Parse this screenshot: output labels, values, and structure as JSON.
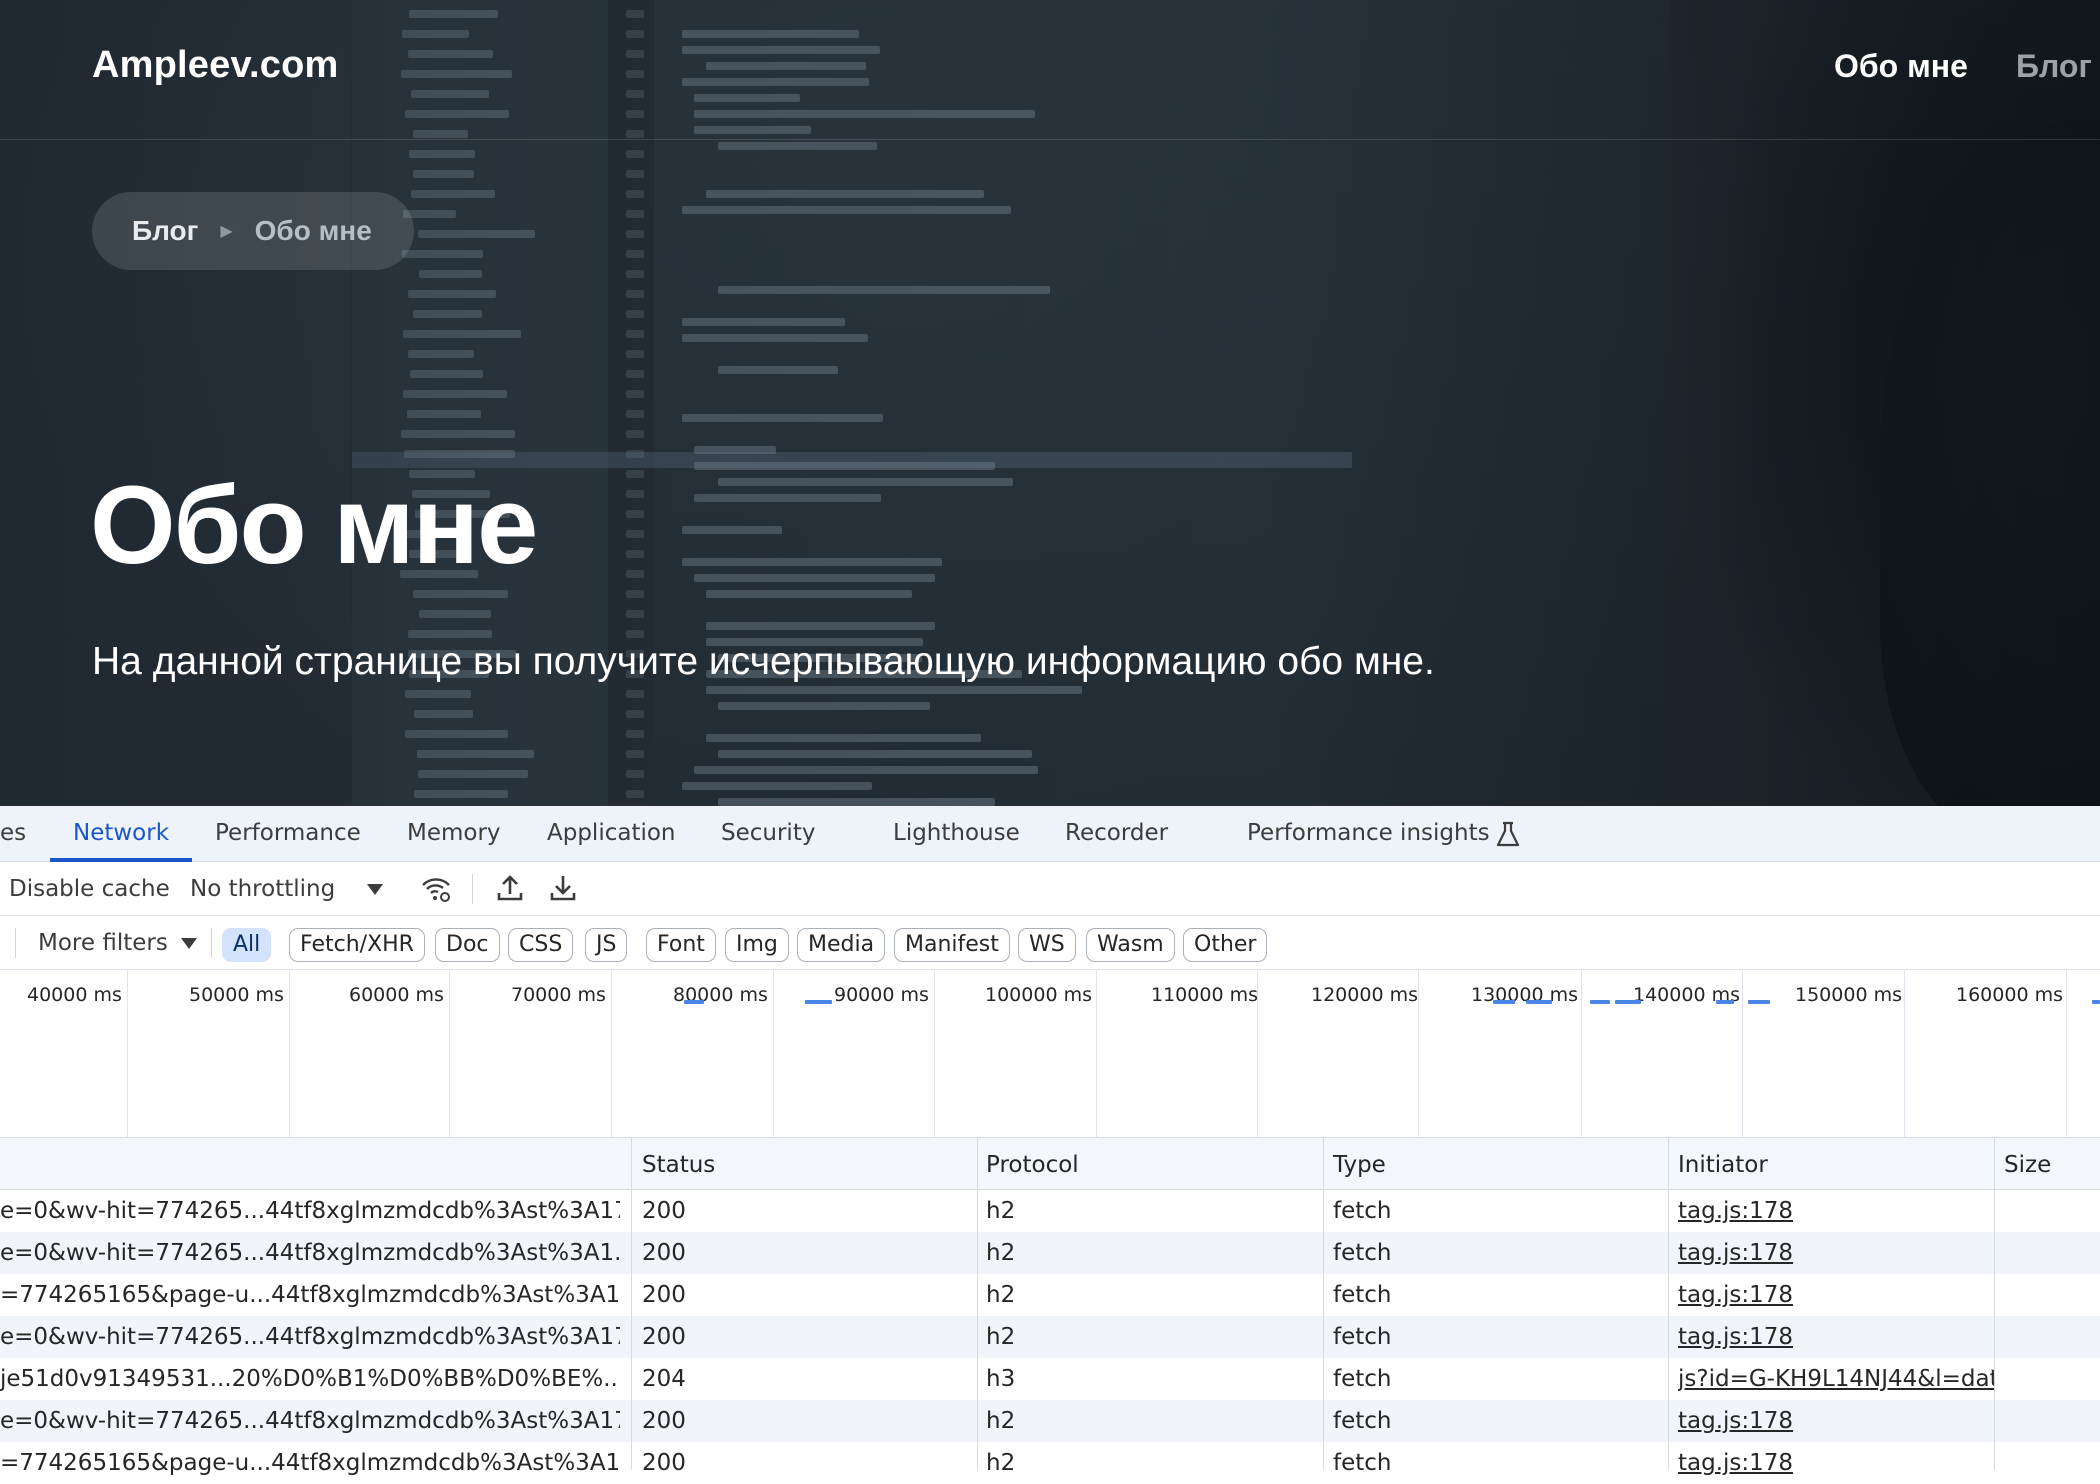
{
  "site": {
    "logo": "Ampleev.com",
    "nav": {
      "about": "Обо мне",
      "blog": "Блог"
    },
    "breadcrumb": {
      "parent": "Блог",
      "separator": "▶",
      "current": "Обо мне"
    },
    "title": "Обо мне",
    "subtitle": "На данной странице вы получите исчерпывающую информацию обо мне."
  },
  "devtools": {
    "tabs": [
      {
        "label": "es"
      },
      {
        "label": "Network"
      },
      {
        "label": "Performance"
      },
      {
        "label": "Memory"
      },
      {
        "label": "Application"
      },
      {
        "label": "Security"
      },
      {
        "label": "Lighthouse"
      },
      {
        "label": "Recorder"
      },
      {
        "label": "Performance insights"
      }
    ],
    "active_tab": "Network",
    "toolbar": {
      "disable_cache": "Disable cache",
      "throttling": "No throttling"
    },
    "filters": {
      "more_filters": "More filters",
      "chips": [
        "All",
        "Fetch/XHR",
        "Doc",
        "CSS",
        "JS",
        "Font",
        "Img",
        "Media",
        "Manifest",
        "WS",
        "Wasm",
        "Other"
      ],
      "selected": "All"
    },
    "overview_ticks": [
      "40000 ms",
      "50000 ms",
      "60000 ms",
      "70000 ms",
      "80000 ms",
      "90000 ms",
      "100000 ms",
      "110000 ms",
      "120000 ms",
      "130000 ms",
      "140000 ms",
      "150000 ms",
      "160000 ms"
    ],
    "columns": {
      "status": "Status",
      "protocol": "Protocol",
      "type": "Type",
      "initiator": "Initiator",
      "size": "Size"
    },
    "rows": [
      {
        "name": "e=0&wv-hit=774265...44tf8xglmzmdcdb%3Ast%3A17...",
        "status": "200",
        "protocol": "h2",
        "type": "fetch",
        "initiator": "tag.js:178"
      },
      {
        "name": "e=0&wv-hit=774265...44tf8xglmzmdcdb%3Ast%3A1...",
        "status": "200",
        "protocol": "h2",
        "type": "fetch",
        "initiator": "tag.js:178"
      },
      {
        "name": "=774265165&page-u...44tf8xglmzmdcdb%3Ast%3A1...",
        "status": "200",
        "protocol": "h2",
        "type": "fetch",
        "initiator": "tag.js:178"
      },
      {
        "name": "e=0&wv-hit=774265...44tf8xglmzmdcdb%3Ast%3A17...",
        "status": "200",
        "protocol": "h2",
        "type": "fetch",
        "initiator": "tag.js:178"
      },
      {
        "name": "je51d0v91349531...20%D0%B1%D0%BB%D0%BE%...",
        "status": "204",
        "protocol": "h3",
        "type": "fetch",
        "initiator": "js?id=G-KH9L14NJ44&l=dat"
      },
      {
        "name": "e=0&wv-hit=774265...44tf8xglmzmdcdb%3Ast%3A17...",
        "status": "200",
        "protocol": "h2",
        "type": "fetch",
        "initiator": "tag.js:178"
      },
      {
        "name": "=774265165&page-u...44tf8xglmzmdcdb%3Ast%3A1...",
        "status": "200",
        "protocol": "h2",
        "type": "fetch",
        "initiator": "tag.js:178"
      }
    ]
  }
}
